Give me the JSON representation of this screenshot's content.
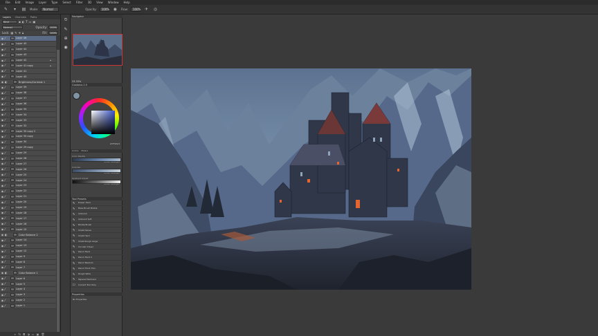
{
  "menu": [
    "File",
    "Edit",
    "Image",
    "Layer",
    "Type",
    "Select",
    "Filter",
    "3D",
    "View",
    "Window",
    "Help"
  ],
  "options_bar": {
    "mode_label": "Mode:",
    "mode_value": "Normal",
    "opacity_label": "Opacity:",
    "opacity_value": "100%",
    "flow_label": "Flow:",
    "flow_value": "100%"
  },
  "layers_panel": {
    "tabs": [
      "Layers",
      "Channels",
      "Paths"
    ],
    "filter_value": "Kind",
    "blend_mode": "Normal",
    "opacity_label": "Opacity:",
    "opacity_value": "100%",
    "lock_label": "Lock:",
    "fill_label": "Fill:",
    "fill_value": "100%",
    "layers": [
      {
        "name": "Layer 46",
        "brush": true
      },
      {
        "name": "Layer 45",
        "brush": true
      },
      {
        "name": "Layer 44",
        "brush": true
      },
      {
        "name": "Layer 43",
        "brush": true
      },
      {
        "name": "Layer 42",
        "brush": true,
        "lock": true
      },
      {
        "name": "Layer 41 copy",
        "brush": true,
        "lock": true
      },
      {
        "name": "Layer 41",
        "brush": true
      },
      {
        "name": "Layer 40",
        "brush": true
      },
      {
        "name": "Brightness/Contrast 1",
        "brush": false,
        "adjustment": true
      },
      {
        "name": "Layer 39",
        "brush": true
      },
      {
        "name": "Layer 38",
        "brush": true
      },
      {
        "name": "Layer 37",
        "brush": true
      },
      {
        "name": "Layer 36",
        "brush": true
      },
      {
        "name": "Layer 35",
        "brush": true
      },
      {
        "name": "Layer 34",
        "brush": true
      },
      {
        "name": "Layer 33",
        "brush": true
      },
      {
        "name": "Layer 32",
        "brush": true
      },
      {
        "name": "Layer 30 copy 2",
        "brush": true
      },
      {
        "name": "Layer 30 copy",
        "brush": true
      },
      {
        "name": "Layer 30",
        "brush": true
      },
      {
        "name": "Layer 29 copy",
        "brush": true
      },
      {
        "name": "Layer 29",
        "brush": true
      },
      {
        "name": "Layer 28",
        "brush": true
      },
      {
        "name": "Layer 27",
        "brush": true
      },
      {
        "name": "Layer 26",
        "brush": true
      },
      {
        "name": "Layer 25",
        "brush": true
      },
      {
        "name": "Layer 24",
        "brush": true
      },
      {
        "name": "Layer 23",
        "brush": true
      },
      {
        "name": "Layer 22",
        "brush": true
      },
      {
        "name": "Layer 21",
        "brush": true
      },
      {
        "name": "Layer 20",
        "brush": true
      },
      {
        "name": "Layer 19",
        "brush": true
      },
      {
        "name": "Layer 18",
        "brush": true
      },
      {
        "name": "Layer 17",
        "brush": true
      },
      {
        "name": "Layer 16",
        "brush": true
      },
      {
        "name": "Layer 15",
        "brush": true
      },
      {
        "name": "Color Balance 2",
        "brush": false,
        "adjustment": true
      },
      {
        "name": "Layer 14",
        "brush": true
      },
      {
        "name": "Layer 13",
        "brush": true
      },
      {
        "name": "Layer 12",
        "brush": true
      },
      {
        "name": "Layer 9",
        "brush": true
      },
      {
        "name": "Layer 8",
        "brush": true
      },
      {
        "name": "Layer 7",
        "brush": true
      },
      {
        "name": "Color Balance 1",
        "brush": false,
        "adjustment": true
      },
      {
        "name": "Layer 6",
        "brush": true
      },
      {
        "name": "Layer 5",
        "brush": true
      },
      {
        "name": "Layer 4",
        "brush": true
      },
      {
        "name": "Layer 3",
        "brush": true
      },
      {
        "name": "Layer 2",
        "brush": true
      },
      {
        "name": "Layer 1",
        "brush": true
      }
    ]
  },
  "navigator": {
    "title": "Navigator",
    "zoom": "33.33%"
  },
  "colour": {
    "title": "Coolorus 2.5",
    "hex": "#7F93A3",
    "current_color": "#7f93a3"
  },
  "mixer": {
    "tabs": [
      "Colors",
      "Mixers"
    ],
    "rows": [
      {
        "label": "Color Palette",
        "mode": "Photo Strength"
      },
      {
        "label": "Colorize",
        "mode": "Photo Strength"
      },
      {
        "label": "Gradient Adjust",
        "mode": "Photo Strength"
      }
    ]
  },
  "tool_presets": {
    "title": "Tool Presets",
    "items": [
      "Eraser Hard",
      "Base Brush Bristle",
      "Airbrush",
      "Airbrush Soft",
      "Bristle Brush",
      "Chalk Dense",
      "Chalk Hard",
      "Chalk Rough Large",
      "Circular Chisel",
      "Pencil Hard",
      "Pencil Hard 2",
      "Pencil Medium",
      "Pencil Thick Thin",
      "Rough Wide",
      "Tapered Textured"
    ],
    "footer_checkbox": "Current Tool Only"
  },
  "properties": {
    "title": "Properties",
    "empty_text": "No Properties"
  }
}
